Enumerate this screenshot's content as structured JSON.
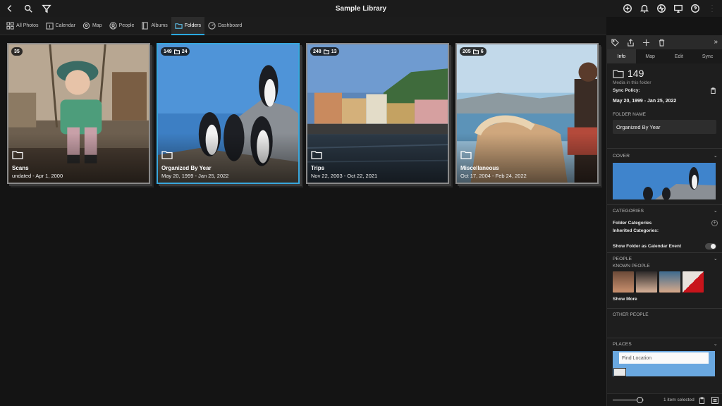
{
  "app": {
    "title": "Sample Library"
  },
  "titlebar_left": [
    "back-icon",
    "search-icon",
    "filter-icon"
  ],
  "titlebar_right": [
    "add-circle-icon",
    "bell-icon",
    "activity-icon",
    "display-icon",
    "help-icon",
    "more-icon"
  ],
  "nav": {
    "tabs": [
      {
        "label": "All Photos",
        "icon": "grid-icon"
      },
      {
        "label": "Calendar",
        "icon": "calendar-icon"
      },
      {
        "label": "Map",
        "icon": "map-pin-icon"
      },
      {
        "label": "People",
        "icon": "person-icon"
      },
      {
        "label": "Albums",
        "icon": "album-icon"
      },
      {
        "label": "Folders",
        "icon": "folder-icon",
        "active": true
      },
      {
        "label": "Dashboard",
        "icon": "gauge-icon"
      }
    ]
  },
  "folders": [
    {
      "name": "Scans",
      "dates": "undated - Apr 1, 2000",
      "count": "35",
      "subfolders": ""
    },
    {
      "name": "Organized By Year",
      "dates": "May 20, 1999 - Jan 25, 2022",
      "count": "149",
      "subfolders": "24",
      "selected": true
    },
    {
      "name": "Trips",
      "dates": "Nov 22, 2003 - Oct 22, 2021",
      "count": "248",
      "subfolders": "13"
    },
    {
      "name": "Miscellaneous",
      "dates": "Oct 17, 2004 - Feb 24, 2022",
      "count": "205",
      "subfolders": "6"
    }
  ],
  "panel": {
    "toolbar_icons": [
      "tag-icon",
      "share-icon",
      "add-icon",
      "trash-icon"
    ],
    "collapse_glyph": "»",
    "tabs": [
      "Info",
      "Map",
      "Edit",
      "Sync"
    ],
    "active_tab": "Info",
    "info": {
      "count": "149",
      "count_caption": "Media in this folder",
      "sync_policy_label": "Sync Policy:",
      "date_range": "May 20, 1999 - Jan 25, 2022",
      "folder_name_label": "FOLDER NAME",
      "folder_name_value": "Organized By Year"
    },
    "cover": {
      "heading": "COVER"
    },
    "categories": {
      "heading": "CATEGORIES",
      "folder_categories": "Folder Categories",
      "inherited_categories": "Inherited Categories:",
      "show_calendar": "Show Folder as Calendar Event"
    },
    "people": {
      "heading": "PEOPLE",
      "known": "KNOWN PEOPLE",
      "show_more": "Show More",
      "other": "OTHER PEOPLE"
    },
    "places": {
      "heading": "PLACES",
      "search_placeholder": "Find Location"
    },
    "status": {
      "selected_text": "1 item selected"
    }
  }
}
